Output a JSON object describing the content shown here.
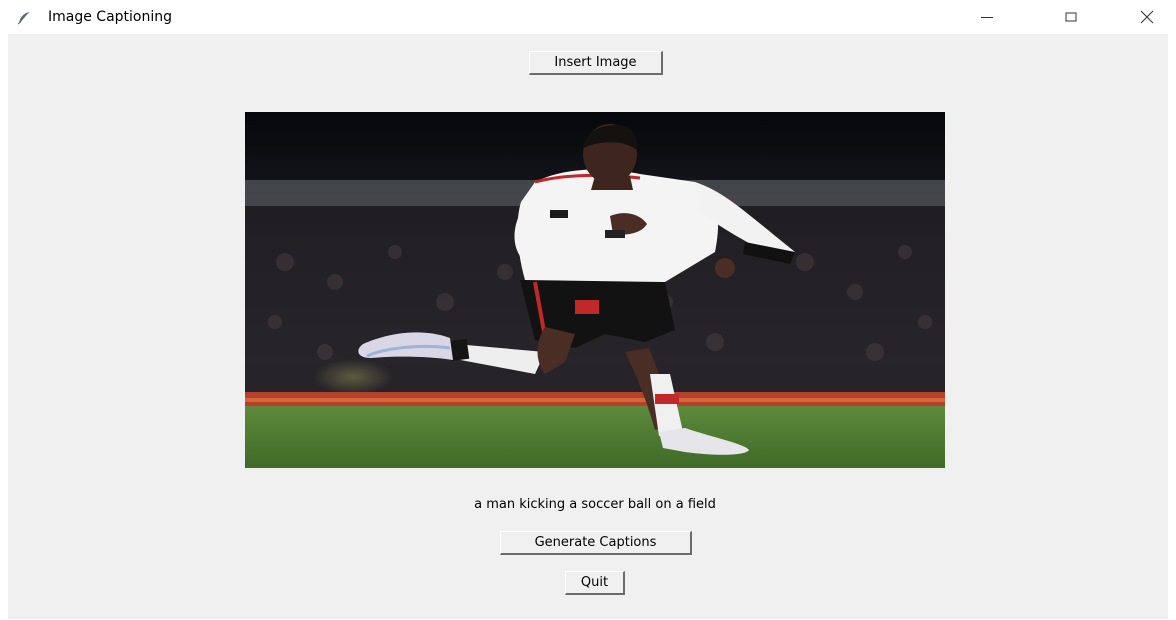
{
  "window": {
    "title": "Image Captioning",
    "app_icon": "feather-icon",
    "controls": [
      "minimize-icon",
      "maximize-icon",
      "close-icon"
    ]
  },
  "toolbar": {
    "insert_label": "Insert Image"
  },
  "image": {
    "subject": "soccer-player-photo"
  },
  "caption": {
    "text": "a man kicking a soccer ball on a field"
  },
  "actions": {
    "generate_label": "Generate Captions",
    "quit_label": "Quit"
  }
}
